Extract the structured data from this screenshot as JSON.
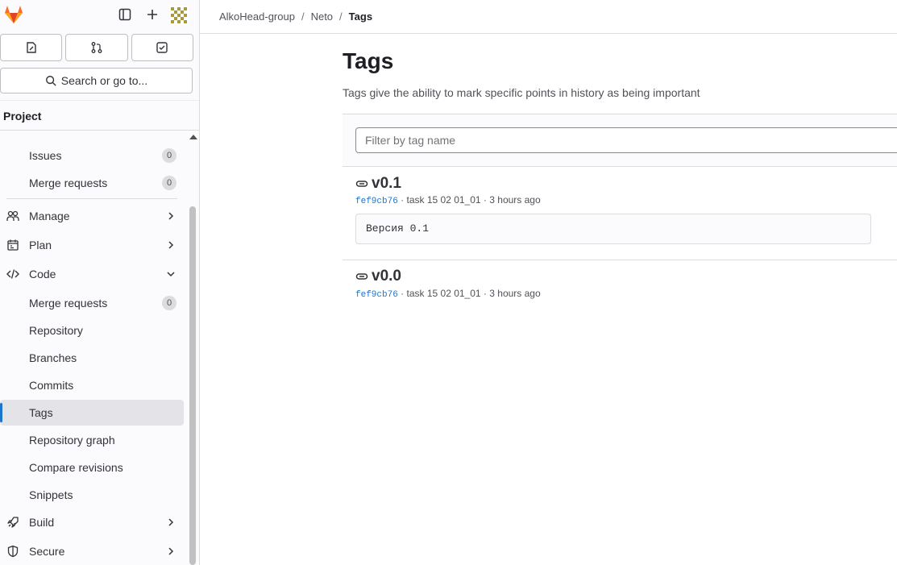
{
  "sidebar": {
    "tabs": [
      {
        "icon": "issues-icon"
      },
      {
        "icon": "merge-request-icon"
      },
      {
        "icon": "todo-icon"
      }
    ],
    "search_label": "Search or go to...",
    "context_title": "Project",
    "items": [
      {
        "label": "Issues",
        "badge": "0"
      },
      {
        "label": "Merge requests",
        "badge": "0"
      },
      {
        "label": "Manage"
      },
      {
        "label": "Plan"
      },
      {
        "label": "Code"
      },
      {
        "label": "Merge requests",
        "badge": "0"
      },
      {
        "label": "Repository"
      },
      {
        "label": "Branches"
      },
      {
        "label": "Commits"
      },
      {
        "label": "Tags",
        "active": true
      },
      {
        "label": "Repository graph"
      },
      {
        "label": "Compare revisions"
      },
      {
        "label": "Snippets"
      },
      {
        "label": "Build"
      },
      {
        "label": "Secure"
      }
    ]
  },
  "breadcrumb": [
    "AlkoHead-group",
    "Neto",
    "Tags"
  ],
  "page": {
    "title": "Tags",
    "description": "Tags give the ability to mark specific points in history as being important",
    "filter_placeholder": "Filter by tag name"
  },
  "tags": [
    {
      "name": "v0.1",
      "sha": "fef9cb76",
      "commit_title": "task 15 02 01_01",
      "time": "3 hours ago",
      "message": "Версия 0.1"
    },
    {
      "name": "v0.0",
      "sha": "fef9cb76",
      "commit_title": "task 15 02 01_01",
      "time": "3 hours ago"
    }
  ],
  "colors": {
    "accent": "#1f75cb",
    "logo_orange": "#e24329"
  }
}
